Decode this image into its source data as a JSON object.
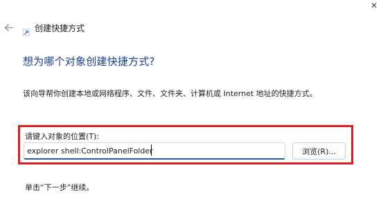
{
  "window": {
    "close_glyph": "✕"
  },
  "header": {
    "back_icon": "back-arrow-icon",
    "title_icon": "shortcut-icon",
    "title": "创建快捷方式"
  },
  "main": {
    "heading": "想为哪个对象创建快捷方式?",
    "description": "该向导帮你创建本地或网络程序、文件、文件夹、计算机或 Internet 地址的快捷方式。",
    "location_label": "请键入对象的位置(T):",
    "location_value": "explorer shell:ControlPanelFolder",
    "browse_label": "浏览(R)...",
    "continue_hint": "单击“下一步”继续。"
  },
  "colors": {
    "heading": "#1b3f8f",
    "highlight_border": "#e02020",
    "input_focus_underline": "#1a5fb4"
  }
}
